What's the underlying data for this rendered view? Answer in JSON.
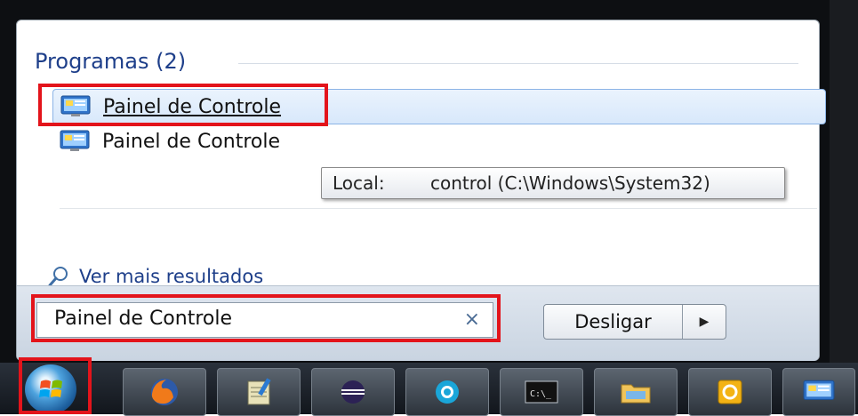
{
  "start_menu": {
    "section_header": "Programas (2)",
    "results": [
      {
        "label": "Painel de Controle",
        "icon": "control-panel-icon"
      },
      {
        "label": "Painel de Controle",
        "icon": "control-panel-icon"
      }
    ],
    "tooltip": {
      "key": "Local:",
      "value": "control (C:\\Windows\\System32)"
    },
    "see_more": "Ver mais resultados",
    "search_value": "Painel de Controle",
    "clear_glyph": "×",
    "shutdown_label": "Desligar",
    "shutdown_arrow": "▶"
  },
  "taskbar": {
    "items": [
      {
        "name": "start-orb",
        "icon": "windows-logo-icon"
      },
      {
        "name": "firefox",
        "icon": "firefox-icon"
      },
      {
        "name": "notepad",
        "icon": "notepad-icon"
      },
      {
        "name": "eclipse",
        "icon": "eclipse-icon"
      },
      {
        "name": "cortana-like",
        "icon": "circle-app-icon"
      },
      {
        "name": "cmd",
        "icon": "command-prompt-icon",
        "label": "C:\\_"
      },
      {
        "name": "explorer",
        "icon": "folder-icon"
      },
      {
        "name": "outlook",
        "icon": "outlook-icon"
      },
      {
        "name": "control-panel",
        "icon": "control-panel-icon"
      }
    ]
  },
  "colors": {
    "accent": "#1e3f8a",
    "highlight": "#e3141b",
    "selection": "#d8e8fb"
  }
}
